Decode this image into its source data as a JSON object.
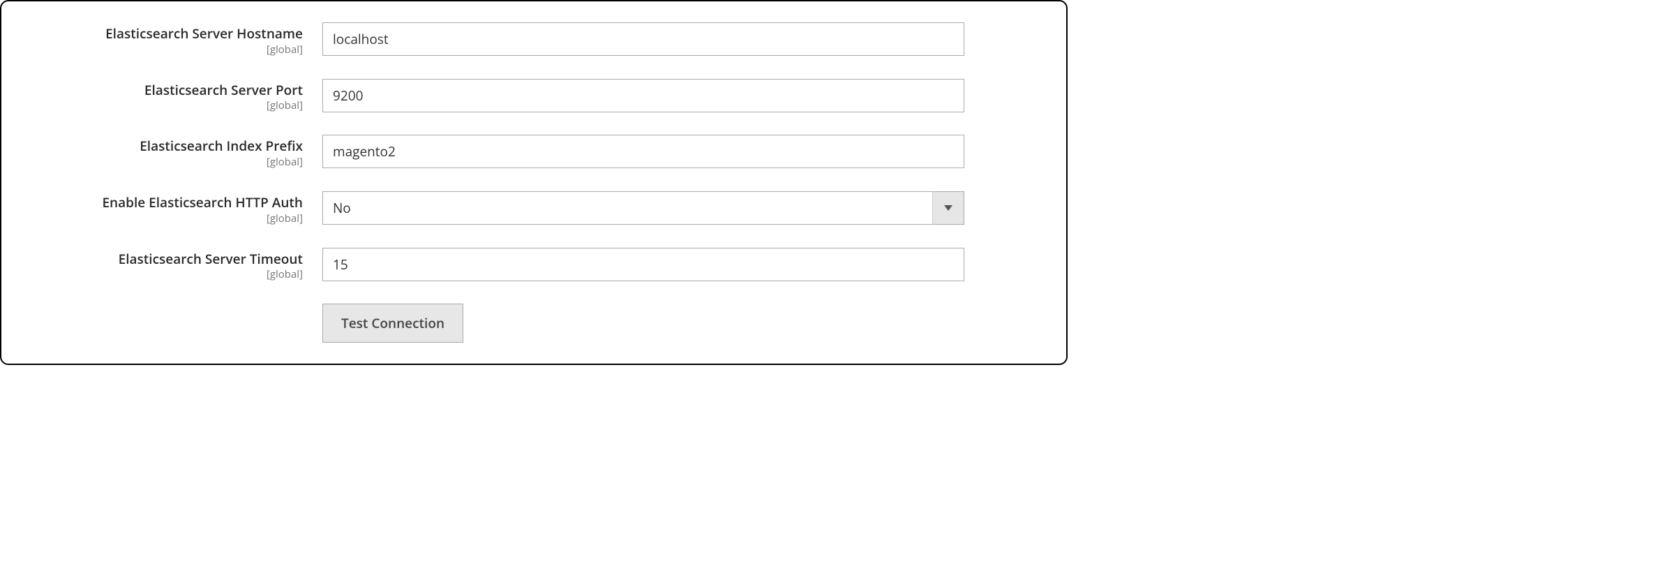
{
  "scope_text": "[global]",
  "fields": {
    "hostname": {
      "label": "Elasticsearch Server Hostname",
      "value": "localhost"
    },
    "port": {
      "label": "Elasticsearch Server Port",
      "value": "9200"
    },
    "index_prefix": {
      "label": "Elasticsearch Index Prefix",
      "value": "magento2"
    },
    "http_auth": {
      "label": "Enable Elasticsearch HTTP Auth",
      "value": "No"
    },
    "timeout": {
      "label": "Elasticsearch Server Timeout",
      "value": "15"
    }
  },
  "actions": {
    "test_connection": "Test Connection"
  }
}
